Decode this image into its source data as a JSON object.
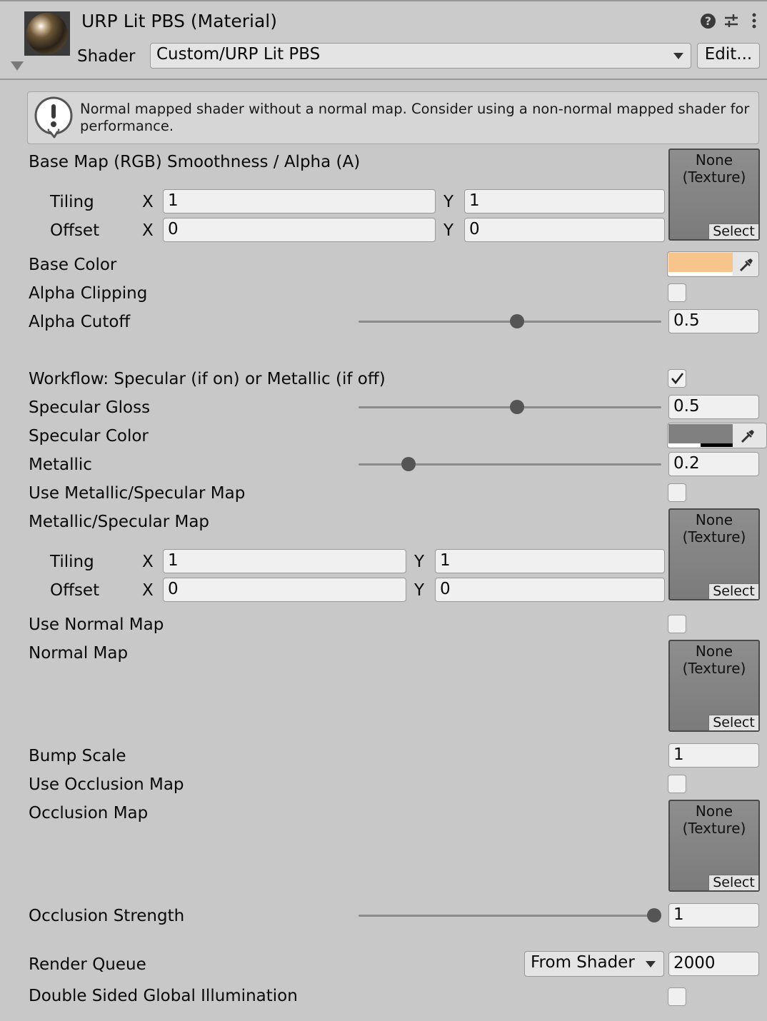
{
  "header": {
    "title": "URP Lit PBS (Material)",
    "shader_label": "Shader",
    "shader_value": "Custom/URP Lit PBS",
    "edit_label": "Edit..."
  },
  "warning": {
    "text": "Normal mapped shader without a normal map. Consider using a non-normal mapped shader for performance."
  },
  "base_map": {
    "label": "Base Map (RGB) Smoothness / Alpha (A)",
    "tiling_label": "Tiling",
    "offset_label": "Offset",
    "x_label": "X",
    "y_label": "Y",
    "tiling_x": "1",
    "tiling_y": "1",
    "offset_x": "0",
    "offset_y": "0",
    "texture_name": "None\n(Texture)",
    "select_label": "Select"
  },
  "base_color": {
    "label": "Base Color",
    "color": "#f7c48b"
  },
  "alpha_clipping": {
    "label": "Alpha Clipping",
    "checked": false
  },
  "alpha_cutoff": {
    "label": "Alpha Cutoff",
    "value": "0.5",
    "fraction": 0.5
  },
  "workflow": {
    "label": "Workflow: Specular (if on) or Metallic (if off)",
    "checked": true
  },
  "specular_gloss": {
    "label": "Specular Gloss",
    "value": "0.5",
    "fraction": 0.5
  },
  "specular_color": {
    "label": "Specular Color",
    "color": "#808080"
  },
  "metallic": {
    "label": "Metallic",
    "value": "0.2",
    "fraction": 0.2
  },
  "use_metallic_map": {
    "label": "Use Metallic/Specular Map",
    "checked": false
  },
  "metallic_map": {
    "label": "Metallic/Specular Map",
    "tiling_label": "Tiling",
    "offset_label": "Offset",
    "x_label": "X",
    "y_label": "Y",
    "tiling_x": "1",
    "tiling_y": "1",
    "offset_x": "0",
    "offset_y": "0",
    "texture_name": "None\n(Texture)",
    "select_label": "Select"
  },
  "use_normal_map": {
    "label": "Use Normal Map",
    "checked": false
  },
  "normal_map": {
    "label": "Normal Map",
    "texture_name": "None\n(Texture)",
    "select_label": "Select"
  },
  "bump_scale": {
    "label": "Bump Scale",
    "value": "1"
  },
  "use_occlusion_map": {
    "label": "Use Occlusion Map",
    "checked": false
  },
  "occlusion_map": {
    "label": "Occlusion Map",
    "texture_name": "None\n(Texture)",
    "select_label": "Select"
  },
  "occlusion_strength": {
    "label": "Occlusion Strength",
    "value": "1",
    "fraction": 1.0
  },
  "render_queue": {
    "label": "Render Queue",
    "mode": "From Shader",
    "value": "2000"
  },
  "double_sided_gi": {
    "label": "Double Sided Global Illumination",
    "checked": false
  }
}
